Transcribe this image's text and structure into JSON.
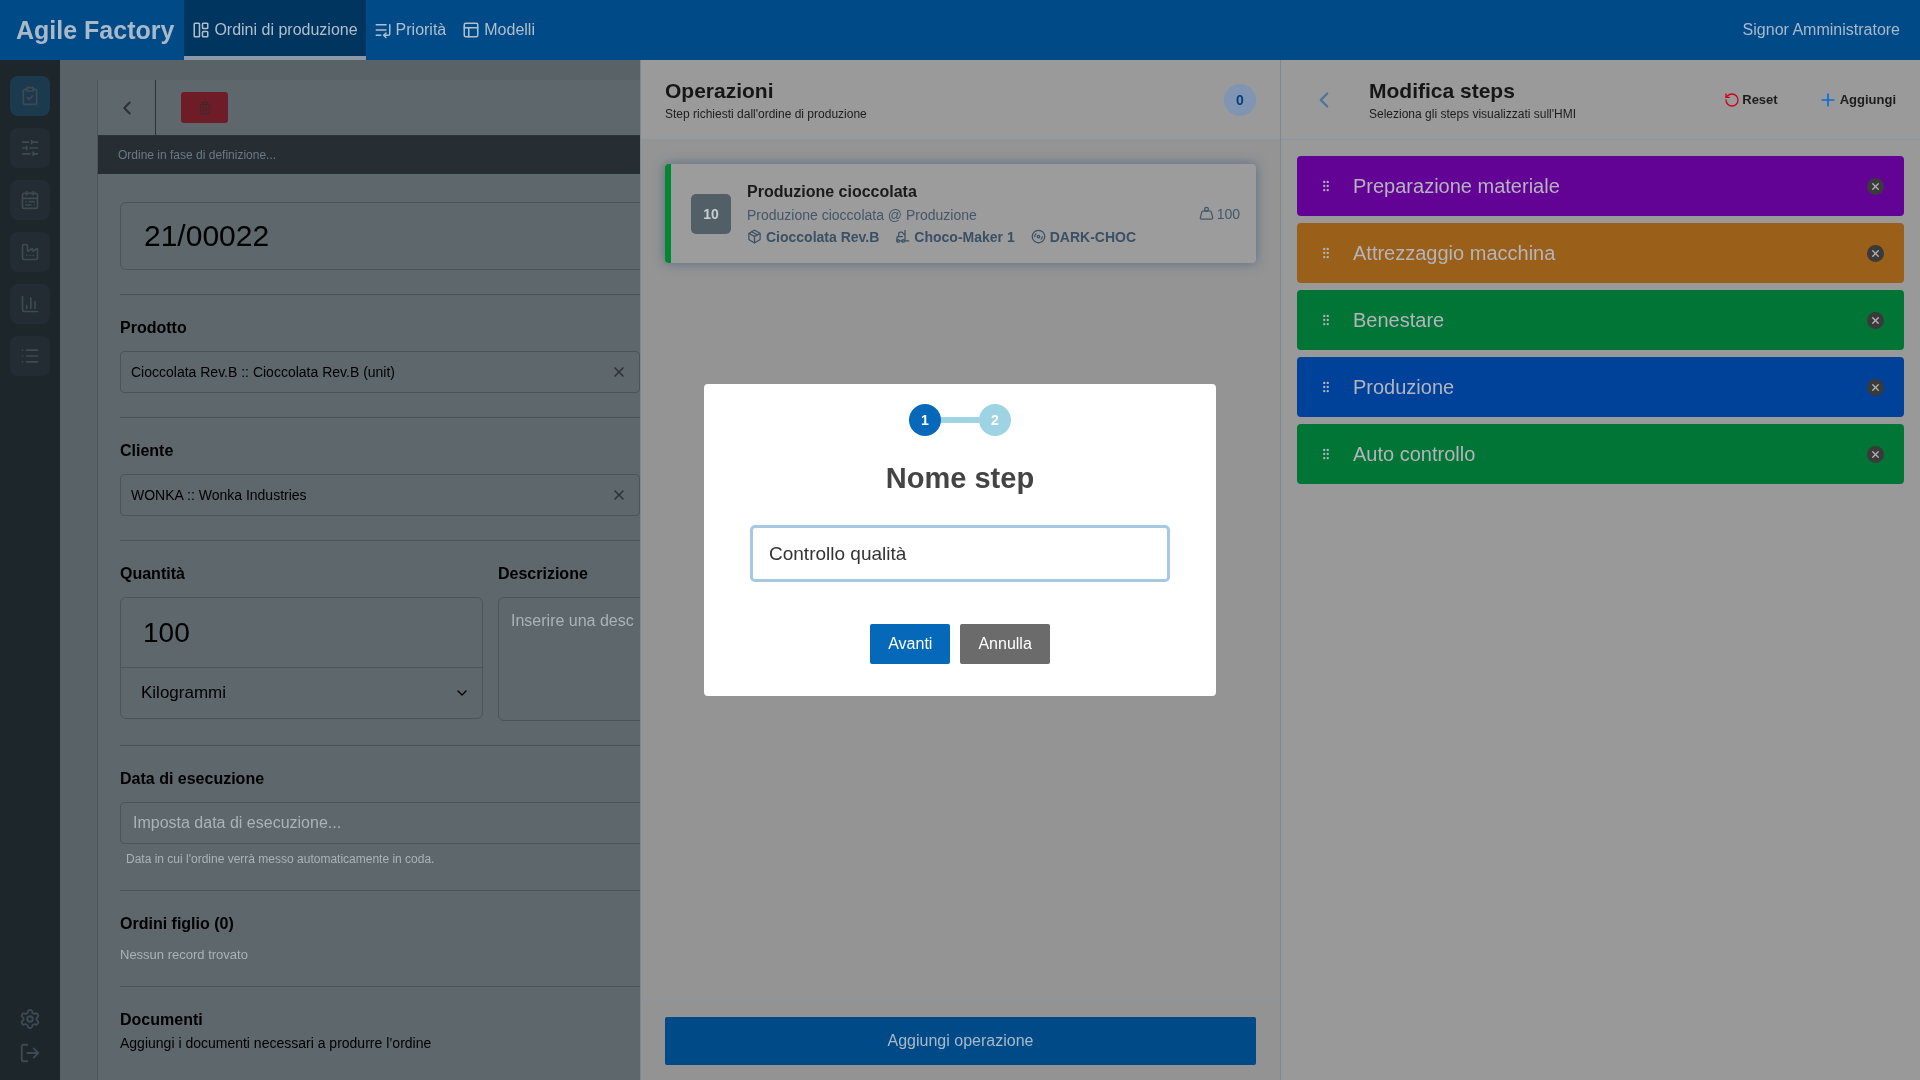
{
  "app": {
    "title": "Agile Factory",
    "user": "Signor Amministratore"
  },
  "nav_tabs": [
    {
      "label": "Ordini di produzione",
      "selected": true
    },
    {
      "label": "Priorità",
      "selected": false
    },
    {
      "label": "Modelli",
      "selected": false
    }
  ],
  "sidebar": {
    "items": [
      {
        "selected": true
      },
      {
        "selected": false
      },
      {
        "selected": false
      },
      {
        "selected": false
      },
      {
        "selected": false
      },
      {
        "selected": false
      }
    ]
  },
  "order_form": {
    "status": "Ordine in fase di definizione...",
    "number": "21/00022",
    "product_label": "Prodotto",
    "product_value": "Cioccolata Rev.B :: Cioccolata Rev.B (unit)",
    "customer_label": "Cliente",
    "customer_value": "WONKA :: Wonka Industries",
    "quantity_label": "Quantità",
    "quantity_value": "100",
    "unit": "Kilogrammi",
    "description_label": "Descrizione",
    "description_placeholder": "Inserire una desc",
    "date_label": "Data di esecuzione",
    "date_placeholder": "Imposta data di esecuzione...",
    "date_hint": "Data in cui l'ordine verrà messo automaticamente in coda.",
    "children_title": "Ordini figlio (0)",
    "children_empty": "Nessun record trovato",
    "documents_title": "Documenti",
    "documents_subtitle": "Aggiungi i documenti necessari a produrre l’ordine"
  },
  "operations": {
    "title": "Operazioni",
    "subtitle": "Step richiesti dall'ordine di produzione",
    "count": "0",
    "add_button": "Aggiungi operazione",
    "items": [
      {
        "number": "10",
        "name": "Produzione cioccolata",
        "detail": "Produzione cioccolata @ Produzione",
        "quantity": "100",
        "product": "Cioccolata Rev.B",
        "machine": "Choco-Maker 1",
        "code": "DARK-CHOC",
        "color": "#00872f"
      }
    ]
  },
  "steps_editor": {
    "title": "Modifica steps",
    "subtitle": "Seleziona gli steps visualizzati sull'HMI",
    "reset": "Reset",
    "add": "Aggiungi",
    "steps": [
      {
        "name": "Preparazione materiale",
        "color": "#630396"
      },
      {
        "name": "Attrezzaggio macchina",
        "color": "#9a5f18"
      },
      {
        "name": "Benestare",
        "color": "#007535"
      },
      {
        "name": "Produzione",
        "color": "#00429a"
      },
      {
        "name": "Auto controllo",
        "color": "#007535"
      }
    ]
  },
  "dialog": {
    "steps": [
      {
        "label": "1",
        "selected": true
      },
      {
        "label": "2",
        "selected": false
      }
    ],
    "title": "Nome step",
    "value": "Controllo qualità",
    "buttons": [
      {
        "label": "Avanti",
        "kind": "primary"
      },
      {
        "label": "Annulla",
        "kind": "secondary"
      }
    ]
  }
}
